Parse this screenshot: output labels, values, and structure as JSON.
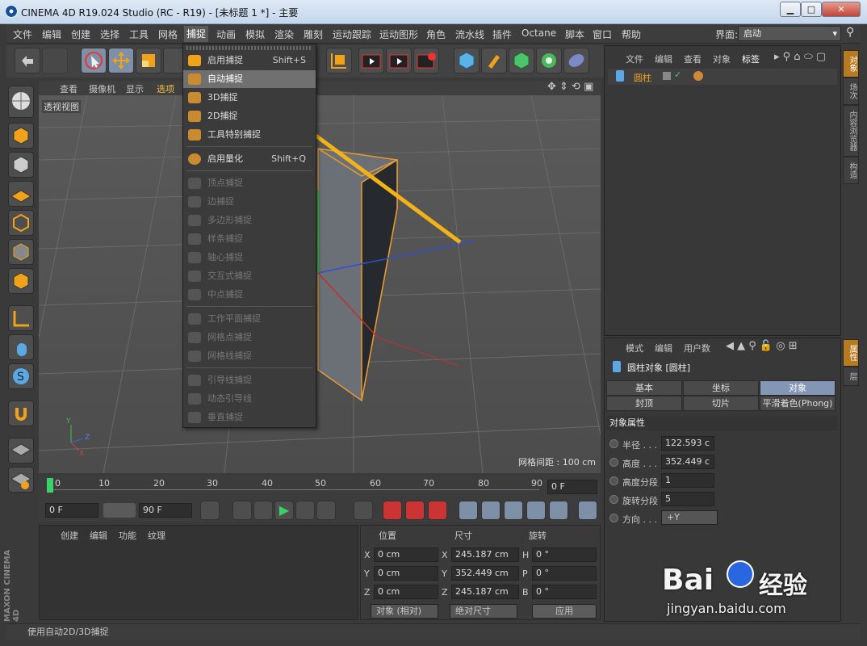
{
  "window": {
    "title": "CINEMA 4D R19.024 Studio (RC - R19) - [未标题 1 *] - 主要",
    "min": "▁",
    "max": "□",
    "close": "✕"
  },
  "menu": [
    "文件",
    "编辑",
    "创建",
    "选择",
    "工具",
    "网格",
    "捕捉",
    "动画",
    "模拟",
    "渲染",
    "雕刻",
    "运动跟踪",
    "运动图形",
    "角色",
    "流水线",
    "插件",
    "Octane",
    "脚本",
    "窗口",
    "帮助"
  ],
  "layout": {
    "label": "界面:",
    "value": "启动"
  },
  "viewport": {
    "menu": [
      "查看",
      "摄像机",
      "显示",
      "选项"
    ],
    "name": "透视视图",
    "grid": "网格间距 : 100 cm"
  },
  "snap_menu": {
    "items": [
      {
        "label": "启用捕捉",
        "shortcut": "Shift+S",
        "enabled": true
      },
      {
        "label": "自动捕捉",
        "shortcut": "",
        "enabled": true,
        "highlight": true
      },
      {
        "label": "3D捕捉",
        "shortcut": "",
        "enabled": true
      },
      {
        "label": "2D捕捉",
        "shortcut": "",
        "enabled": true
      },
      {
        "label": "工具特别捕捉",
        "shortcut": "",
        "enabled": true
      },
      {
        "label": "启用量化",
        "shortcut": "Shift+Q",
        "enabled": true
      },
      {
        "label": "顶点捕捉",
        "enabled": false
      },
      {
        "label": "边捕捉",
        "enabled": false
      },
      {
        "label": "多边形捕捉",
        "enabled": false
      },
      {
        "label": "样条捕捉",
        "enabled": false
      },
      {
        "label": "轴心捕捉",
        "enabled": false
      },
      {
        "label": "交互式捕捉",
        "enabled": false
      },
      {
        "label": "中点捕捉",
        "enabled": false
      },
      {
        "label": "工作平面捕捉",
        "enabled": false
      },
      {
        "label": "网格点捕捉",
        "enabled": false
      },
      {
        "label": "网格线捕捉",
        "enabled": false
      },
      {
        "label": "引导线捕捉",
        "enabled": false
      },
      {
        "label": "动态引导线",
        "enabled": false
      },
      {
        "label": "垂直捕捉",
        "enabled": false
      }
    ]
  },
  "timeline": {
    "ticks": [
      "0",
      "10",
      "20",
      "30",
      "40",
      "50",
      "60",
      "70",
      "80",
      "90"
    ],
    "current": "0 F",
    "start": "0 F",
    "end": "90 F"
  },
  "material": {
    "menu": [
      "创建",
      "编辑",
      "功能",
      "纹理"
    ]
  },
  "coords": {
    "headers": [
      "位置",
      "尺寸",
      "旋转"
    ],
    "rows": [
      {
        "a": "X",
        "pos": "0 cm",
        "b": "X",
        "size": "245.187 cm",
        "c": "H",
        "rot": "0 °"
      },
      {
        "a": "Y",
        "pos": "0 cm",
        "b": "Y",
        "size": "352.449 cm",
        "c": "P",
        "rot": "0 °"
      },
      {
        "a": "Z",
        "pos": "0 cm",
        "b": "Z",
        "size": "245.187 cm",
        "c": "B",
        "rot": "0 °"
      }
    ],
    "mode": "对象 (相对)",
    "size_mode": "绝对尺寸",
    "apply": "应用"
  },
  "objects": {
    "menu": [
      "文件",
      "编辑",
      "查看",
      "对象",
      "标签"
    ],
    "item": "圆柱"
  },
  "attributes": {
    "menu": [
      "模式",
      "编辑",
      "用户数"
    ],
    "title": "圆柱对象 [圆柱]",
    "tabs": [
      "基本",
      "坐标",
      "对象",
      "封顶",
      "切片",
      "平滑着色(Phong)"
    ],
    "section": "对象属性",
    "props": [
      {
        "label": "半径 . . .",
        "value": "122.593 c"
      },
      {
        "label": "高度 . . .",
        "value": "352.449 c"
      },
      {
        "label": "高度分段",
        "value": "1"
      },
      {
        "label": "旋转分段",
        "value": "5"
      },
      {
        "label": "方向 . . .",
        "value": "+Y"
      }
    ]
  },
  "side_tabs_top": [
    "对象",
    "场次",
    "内容浏览器",
    "构造"
  ],
  "side_tabs_bottom": [
    "属性",
    "层"
  ],
  "status": "使用自动2D/3D捕捉",
  "watermark": {
    "brand": "Bai",
    "brand2": "经验",
    "url": "jingyan.baidu.com"
  },
  "maxon": "MAXON CINEMA 4D",
  "colors": {
    "accent": "#e8a11c",
    "highlight": "#8496b6",
    "arrow": "#f2b318"
  }
}
